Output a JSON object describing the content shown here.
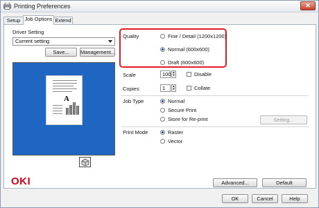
{
  "window": {
    "title": "Printing Preferences",
    "close_glyph": "✕"
  },
  "tabs": [
    {
      "label": "Setup"
    },
    {
      "label": "Job Options"
    },
    {
      "label": "Extend"
    }
  ],
  "driver_setting": {
    "label": "Driver Setting",
    "selected": "Current setting",
    "save_label": "Save...",
    "management_label": "Management..."
  },
  "preview": {
    "letter": "A"
  },
  "quality": {
    "label": "Quality",
    "options": [
      {
        "label": "Fine / Detail (1200x1200)",
        "selected": false
      },
      {
        "label": "Normal (600x600)",
        "selected": true
      },
      {
        "label": "Draft (600x600)",
        "selected": false
      }
    ]
  },
  "scale": {
    "label": "Scale",
    "value": "100",
    "disable_label": "Disable"
  },
  "copies": {
    "label": "Copies:",
    "value": "1",
    "collate_label": "Collate"
  },
  "job_type": {
    "label": "Job Type",
    "options": [
      {
        "label": "Normal",
        "selected": true
      },
      {
        "label": "Secure Print",
        "selected": false
      },
      {
        "label": "Store for Re-print",
        "selected": false
      }
    ],
    "setting_label": "Setting..."
  },
  "print_mode": {
    "label": "Print Mode",
    "options": [
      {
        "label": "Raster",
        "selected": true
      },
      {
        "label": "Vector",
        "selected": false
      }
    ]
  },
  "brand": "OKI",
  "actions": {
    "advanced_label": "Advanced...",
    "default_label": "Default",
    "ok_label": "OK",
    "cancel_label": "Cancel",
    "help_label": "Help"
  },
  "colors": {
    "highlight": "#e01b24",
    "preview_bg": "#1e66c2",
    "brand": "#d9001b"
  }
}
